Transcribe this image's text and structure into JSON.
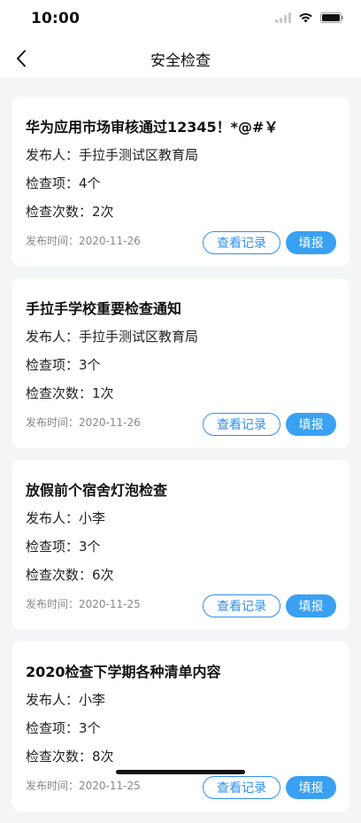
{
  "status_bar": {
    "time": "10:00"
  },
  "nav": {
    "title": "安全检查"
  },
  "cards": [
    {
      "title": "华为应用市场审核通过12345！*@#￥",
      "publisher": "发布人：手拉手测试区教育局",
      "items": "检查项：4个",
      "count": "检查次数：2次",
      "time": "发布时间：2020-11-26",
      "records_label": "查看记录",
      "fill_label": "填报"
    },
    {
      "title": "手拉手学校重要检查通知",
      "publisher": "发布人：手拉手测试区教育局",
      "items": "检查项：3个",
      "count": "检查次数：1次",
      "time": "发布时间：2020-11-26",
      "records_label": "查看记录",
      "fill_label": "填报"
    },
    {
      "title": "放假前个宿舍灯泡检查",
      "publisher": "发布人：小李",
      "items": "检查项：3个",
      "count": "检查次数：6次",
      "time": "发布时间：2020-11-25",
      "records_label": "查看记录",
      "fill_label": "填报"
    },
    {
      "title": "2020检查下学期各种清单内容",
      "publisher": "发布人：小李",
      "items": "检查项：3个",
      "count": "检查次数：8次",
      "time": "发布时间：2020-11-25",
      "records_label": "查看记录",
      "fill_label": "填报"
    }
  ]
}
